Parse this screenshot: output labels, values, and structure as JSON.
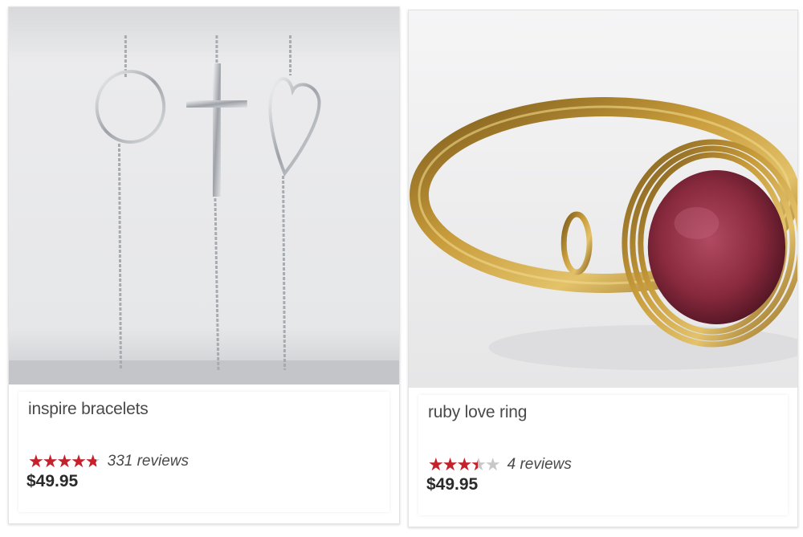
{
  "products": [
    {
      "name": "inspire bracelets",
      "rating": 4.8,
      "rating_max": 5,
      "reviews": "331 reviews",
      "price": "$49.95"
    },
    {
      "name": "ruby love ring",
      "rating": 3.5,
      "rating_max": 5,
      "reviews": "4 reviews",
      "price": "$49.95"
    }
  ],
  "colors": {
    "star_filled": "#c8202a",
    "star_empty": "#c8c8c8",
    "gold": "#b8902a",
    "ruby": "#8a2a3e",
    "silver": "#cfd2d6"
  },
  "icons": [
    "star-icon"
  ]
}
